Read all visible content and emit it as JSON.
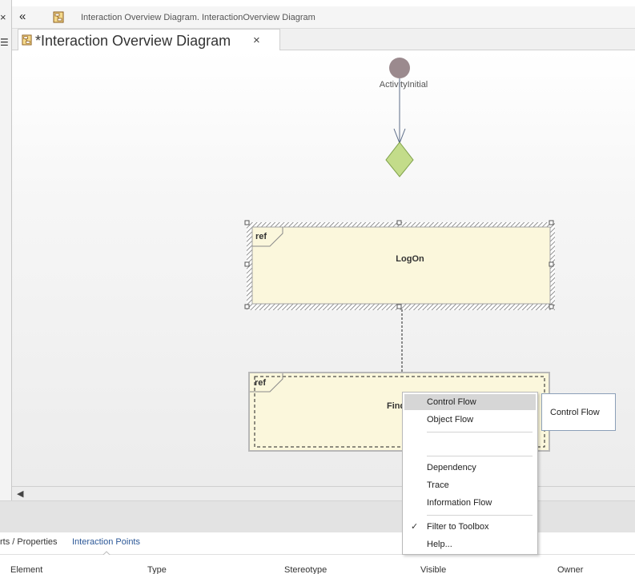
{
  "breadcrumb": {
    "back_glyph": "«",
    "path": "Interaction Overview Diagram.  InteractionOverview Diagram",
    "icon": "diagram-icon"
  },
  "left_pane": {
    "close_glyph": "×",
    "menu_glyph": "☰"
  },
  "tab": {
    "title": "*Interaction Overview Diagram",
    "close_glyph": "×",
    "icon": "diagram-icon"
  },
  "diagram": {
    "initial_label": "ActivityInitial",
    "frames": [
      {
        "tag": "ref",
        "name": "LogOn"
      },
      {
        "tag": "ref",
        "name": "Find"
      }
    ],
    "colors": {
      "frame_fill": "#fbf7dc",
      "decision_fill": "#c3dc8a",
      "initial_fill": "#9b8a8e"
    }
  },
  "context_menu": {
    "items": [
      {
        "label": "Control Flow",
        "highlighted": true
      },
      {
        "label": "Object Flow"
      },
      {
        "label": "Dependency"
      },
      {
        "label": "Trace"
      },
      {
        "label": "Information Flow"
      },
      {
        "label": "Filter to Toolbox",
        "checked": true
      },
      {
        "label": "Help..."
      }
    ],
    "check_glyph": "✓"
  },
  "tooltip": {
    "text": "Control Flow"
  },
  "scrollbar": {
    "left_glyph": "◀"
  },
  "bottom_tabs": [
    {
      "label": "rts / Properties"
    },
    {
      "label": "Interaction Points",
      "active": true
    }
  ],
  "columns": [
    "Element",
    "Type",
    "Stereotype",
    "Visible",
    "Owner"
  ]
}
